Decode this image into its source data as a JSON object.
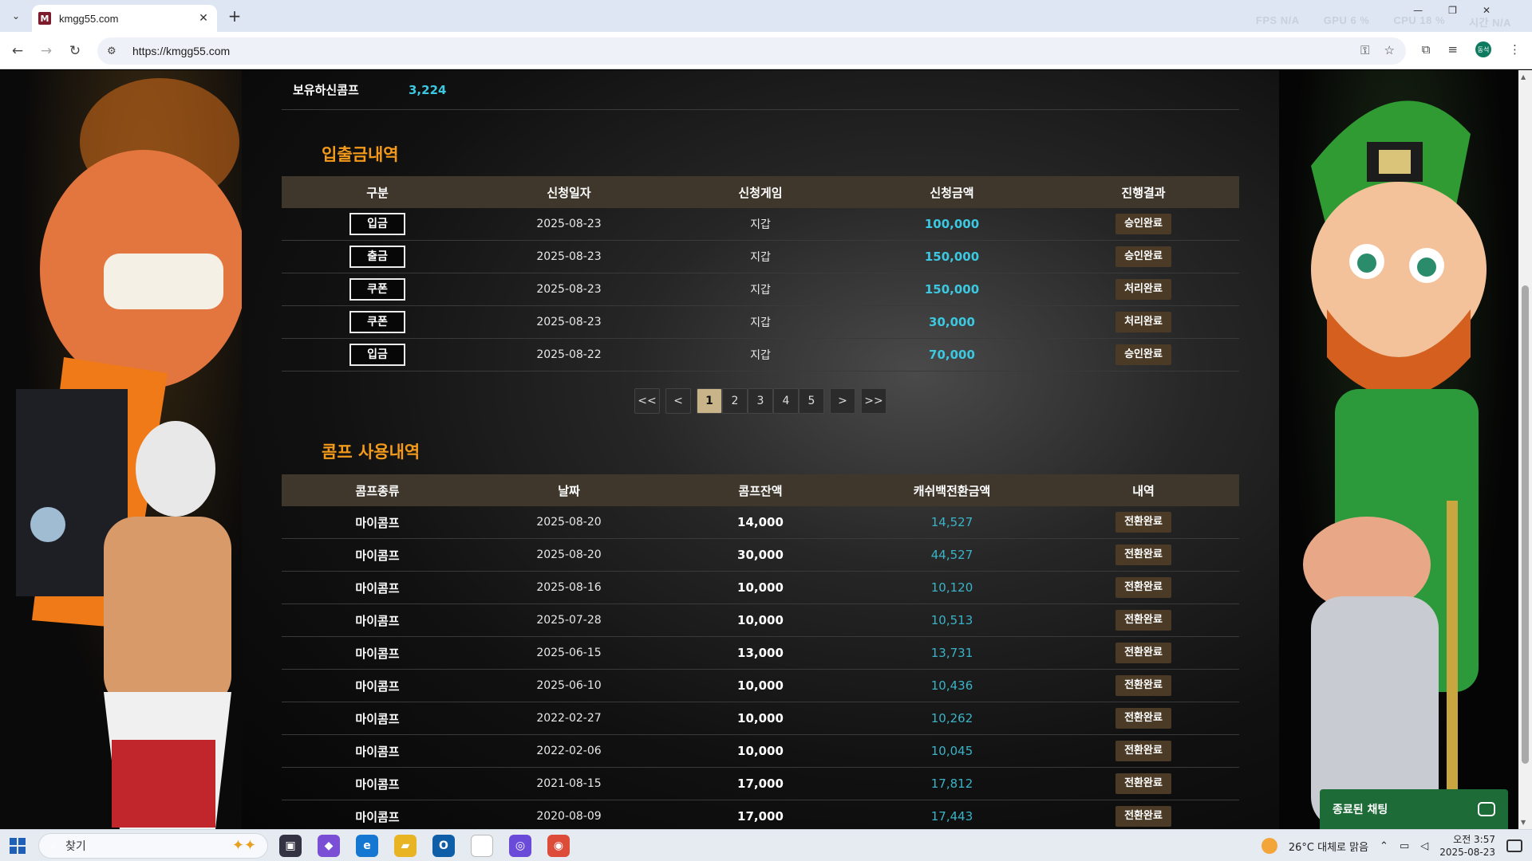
{
  "browser": {
    "tab_title": "kmgg55.com",
    "favicon_letter": "M",
    "url": "https://kmgg55.com",
    "perf": {
      "fps": "FPS  N/A",
      "gpu": "GPU  6 %",
      "cpu": "CPU  18 %",
      "extra": "시간   N/A"
    },
    "profile_label": "동석"
  },
  "balance": {
    "label": "보유하신콤프",
    "value": "3,224"
  },
  "deposit_history": {
    "title": "입출금내역",
    "columns": [
      "구분",
      "신청일자",
      "신청게임",
      "신청금액",
      "진행결과"
    ],
    "rows": [
      {
        "type": "입금",
        "date": "2025-08-23",
        "game": "지갑",
        "amount": "100,000",
        "status": "승인완료"
      },
      {
        "type": "출금",
        "date": "2025-08-23",
        "game": "지갑",
        "amount": "150,000",
        "status": "승인완료"
      },
      {
        "type": "쿠폰",
        "date": "2025-08-23",
        "game": "지갑",
        "amount": "150,000",
        "status": "처리완료"
      },
      {
        "type": "쿠폰",
        "date": "2025-08-23",
        "game": "지갑",
        "amount": "30,000",
        "status": "처리완료"
      },
      {
        "type": "입금",
        "date": "2025-08-22",
        "game": "지갑",
        "amount": "70,000",
        "status": "승인완료"
      }
    ]
  },
  "pagination": {
    "first": "<<",
    "prev": "<",
    "pages": [
      "1",
      "2",
      "3",
      "4",
      "5"
    ],
    "active": "1",
    "next": ">",
    "last": ">>"
  },
  "comp_history": {
    "title": "콤프 사용내역",
    "columns": [
      "콤프종류",
      "날짜",
      "콤프잔액",
      "캐쉬백전환금액",
      "내역"
    ],
    "rows": [
      {
        "kind": "마이콤프",
        "date": "2025-08-20",
        "balance": "14,000",
        "cashback": "14,527",
        "status": "전환완료"
      },
      {
        "kind": "마이콤프",
        "date": "2025-08-20",
        "balance": "30,000",
        "cashback": "44,527",
        "status": "전환완료"
      },
      {
        "kind": "마이콤프",
        "date": "2025-08-16",
        "balance": "10,000",
        "cashback": "10,120",
        "status": "전환완료"
      },
      {
        "kind": "마이콤프",
        "date": "2025-07-28",
        "balance": "10,000",
        "cashback": "10,513",
        "status": "전환완료"
      },
      {
        "kind": "마이콤프",
        "date": "2025-06-15",
        "balance": "13,000",
        "cashback": "13,731",
        "status": "전환완료"
      },
      {
        "kind": "마이콤프",
        "date": "2025-06-10",
        "balance": "10,000",
        "cashback": "10,436",
        "status": "전환완료"
      },
      {
        "kind": "마이콤프",
        "date": "2022-02-27",
        "balance": "10,000",
        "cashback": "10,262",
        "status": "전환완료"
      },
      {
        "kind": "마이콤프",
        "date": "2022-02-06",
        "balance": "10,000",
        "cashback": "10,045",
        "status": "전환완료"
      },
      {
        "kind": "마이콤프",
        "date": "2021-08-15",
        "balance": "17,000",
        "cashback": "17,812",
        "status": "전환완료"
      },
      {
        "kind": "마이콤프",
        "date": "2020-08-09",
        "balance": "17,000",
        "cashback": "17,443",
        "status": "전환완료"
      }
    ]
  },
  "chat": {
    "label": "종료된 채팅"
  },
  "taskbar": {
    "search_placeholder": "찾기",
    "weather": "26°C  대체로 맑음",
    "time": "오전 3:57",
    "date": "2025-08-23"
  },
  "colors": {
    "accent_orange": "#f49a1b",
    "cyan": "#3cc8e0",
    "header_bg": "#3f372c",
    "status_bg": "#4a3a26",
    "chat_green": "#1d6b36"
  }
}
